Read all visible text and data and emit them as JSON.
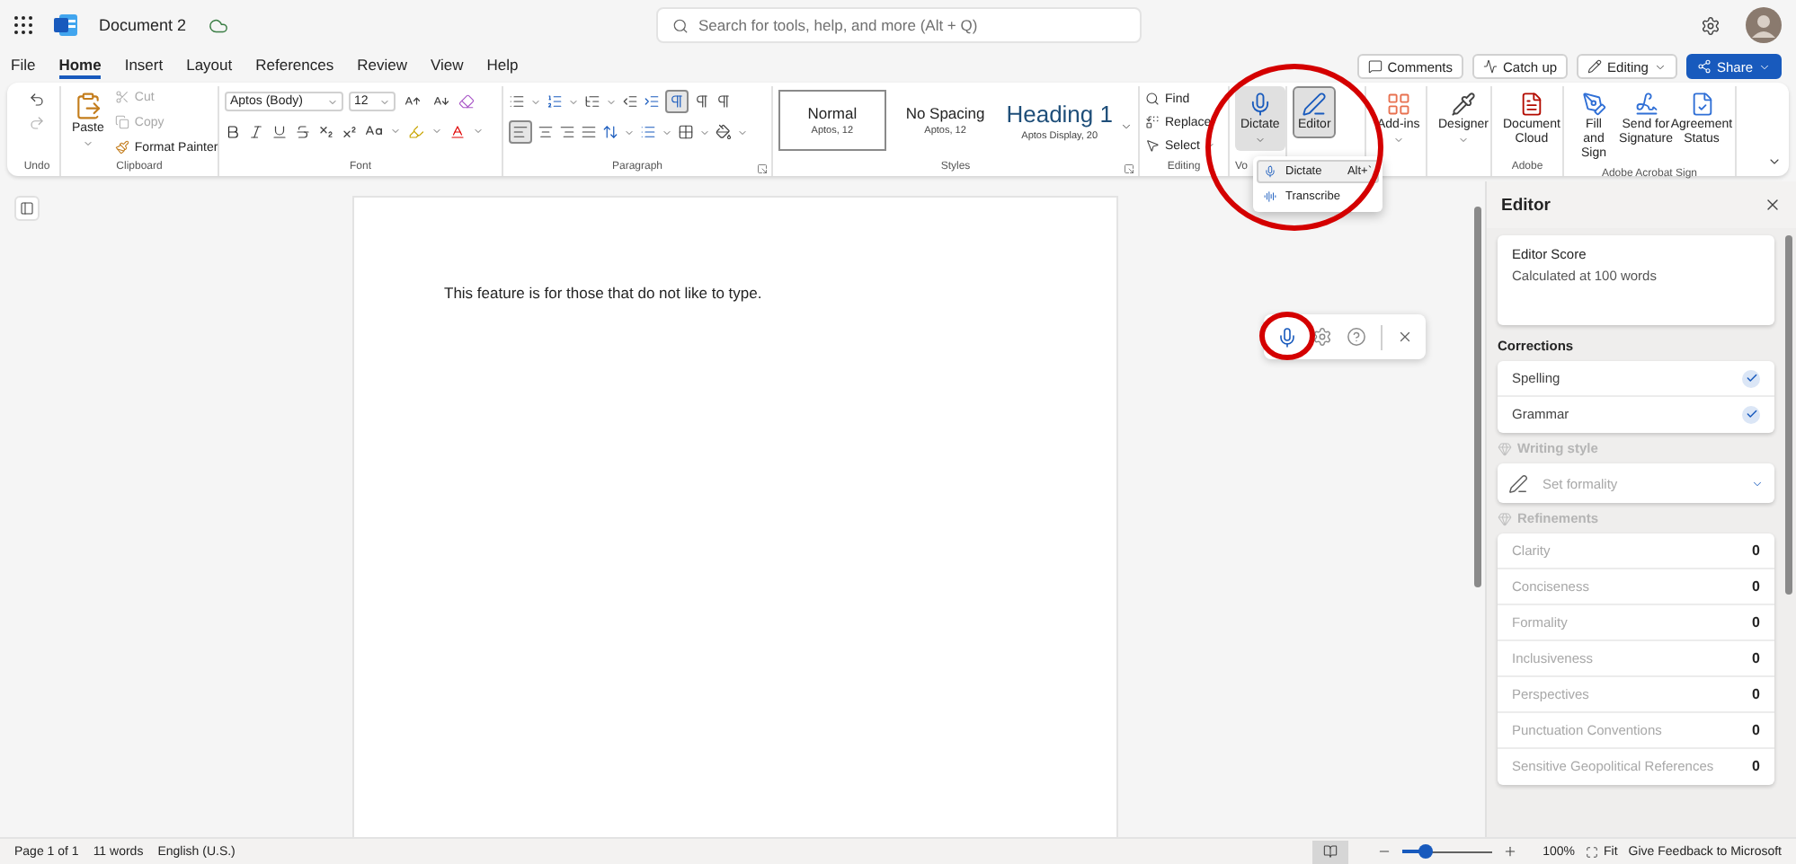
{
  "title_bar": {
    "document_title": "Document 2",
    "search": {
      "placeholder": "Search for tools, help, and more (Alt + Q)"
    }
  },
  "tabs": [
    {
      "label": "File",
      "selected": false
    },
    {
      "label": "Home",
      "selected": true
    },
    {
      "label": "Insert",
      "selected": false
    },
    {
      "label": "Layout",
      "selected": false
    },
    {
      "label": "References",
      "selected": false
    },
    {
      "label": "Review",
      "selected": false
    },
    {
      "label": "View",
      "selected": false
    },
    {
      "label": "Help",
      "selected": false
    }
  ],
  "actions": [
    {
      "label": "Comments",
      "kind": "plain"
    },
    {
      "label": "Catch up",
      "kind": "plain"
    },
    {
      "label": "Editing",
      "kind": "menu"
    },
    {
      "label": "Share",
      "kind": "primary"
    }
  ],
  "ribbon": {
    "undo": {
      "label": "Undo"
    },
    "clipboard": {
      "label": "Clipboard",
      "paste": "Paste",
      "items": [
        {
          "label": "Cut",
          "disabled": true
        },
        {
          "label": "Copy",
          "disabled": true
        },
        {
          "label": "Format Painter",
          "disabled": false
        }
      ]
    },
    "font": {
      "label": "Font",
      "font_name": "Aptos (Body)",
      "font_size": "12"
    },
    "paragraph": {
      "label": "Paragraph"
    },
    "styles": {
      "label": "Styles",
      "items": [
        {
          "name": "Normal",
          "detail": "Aptos, 12",
          "selected": true
        },
        {
          "name": "No Spacing",
          "detail": "Aptos, 12",
          "selected": false
        },
        {
          "name": "Heading 1",
          "detail": "Aptos Display, 20",
          "selected": false
        }
      ]
    },
    "editing": {
      "label": "Editing",
      "items": [
        "Find",
        "Replace",
        "Select"
      ]
    },
    "voice": {
      "label": "Vo",
      "dictate": "Dictate",
      "pressed": true
    },
    "editor": {
      "label": "Editor",
      "pressed": true
    },
    "addins": "Add-ins",
    "designer": "Designer",
    "adobe": {
      "label": "Adobe",
      "document_cloud": "Document Cloud"
    },
    "acrobat_sign": {
      "label": "Adobe Acrobat Sign",
      "items": [
        "Fill and Sign",
        "Send for Signature",
        "Agreement Status"
      ]
    }
  },
  "dictate_menu": [
    {
      "label": "Dictate",
      "shortcut": "Alt+`",
      "selected": true
    },
    {
      "label": "Transcribe",
      "selected": false
    }
  ],
  "document": {
    "text": "This feature is for those that do not like to type."
  },
  "editor_panel": {
    "title": "Editor",
    "score": {
      "title": "Editor Score",
      "detail": "Calculated at 100 words"
    },
    "corrections": {
      "heading": "Corrections",
      "items": [
        {
          "label": "Spelling",
          "checked": true
        },
        {
          "label": "Grammar",
          "checked": true
        }
      ]
    },
    "writing_style": {
      "heading": "Writing style",
      "disabled": true,
      "formality": "Set formality"
    },
    "refinements": {
      "heading": "Refinements",
      "disabled": true,
      "items": [
        {
          "label": "Clarity",
          "count": "0"
        },
        {
          "label": "Conciseness",
          "count": "0"
        },
        {
          "label": "Formality",
          "count": "0"
        },
        {
          "label": "Inclusiveness",
          "count": "0"
        },
        {
          "label": "Perspectives",
          "count": "0"
        },
        {
          "label": "Punctuation Conventions",
          "count": "0"
        },
        {
          "label": "Sensitive Geopolitical References",
          "count": "0"
        }
      ]
    }
  },
  "status_bar": {
    "left": [
      "Page 1 of 1",
      "11 words",
      "English (U.S.)"
    ],
    "zoom": {
      "level": 0.25,
      "reading": "100%"
    },
    "fit": "Fit",
    "feedback": "Give Feedback to Microsoft"
  }
}
